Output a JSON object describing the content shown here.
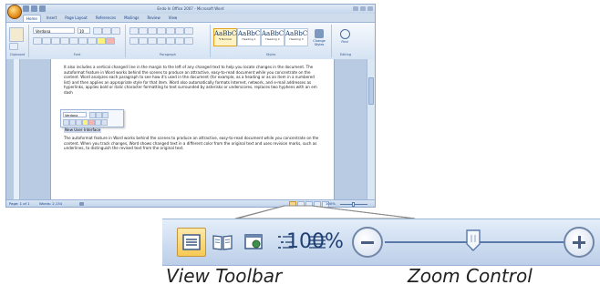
{
  "word_window": {
    "title": "Endo In Office 2007 - Microsoft Word",
    "ribbon_tabs": [
      "Home",
      "Insert",
      "Page Layout",
      "References",
      "Mailings",
      "Review",
      "View"
    ],
    "active_tab": "Home",
    "font_name": "Verdana",
    "font_size": "10",
    "groups": {
      "clipboard": "Clipboard",
      "font": "Font",
      "paragraph": "Paragraph",
      "styles": "Styles",
      "editing": "Editing"
    },
    "styles": [
      {
        "sample": "AaBbCcD",
        "name": "¶ Normal"
      },
      {
        "sample": "AaBbC",
        "name": "Heading 1"
      },
      {
        "sample": "AaBbC",
        "name": "Heading 2"
      },
      {
        "sample": "AaBbC",
        "name": "Heading 3"
      }
    ],
    "change_styles_label": "Change Styles",
    "find_label": "Find",
    "paragraphs": [
      "It also includes a vertical changed line in the margin to the left of any changed text to help you locate changes in the document. The autoformat feature in Word works behind the scenes to produce an attractive, easy-to-read document while you concentrate on the content. Word analyzes each paragraph to see how it's used in the document (for example, as a heading or as an item in a numbered list) and then applies an appropriate style for that item. Word also automatically formats Internet, network, and e-mail addresses as hyperlinks, applies bold or italic character formatting to text surrounded by asterisks or underscores, replaces two hyphens with an em dash",
      "The autoformat feature in Word works behind the scenes to produce an attractive, easy-to-read document while you concentrate on the content. When you track changes, Word shows changed text in a different color from the original text and uses revision marks, such as underlines, to distinguish the revised text from the original text."
    ],
    "selected_text": "New User Interface",
    "mini_toolbar_font": "Verdana",
    "status": {
      "page": "Page: 1 of 1",
      "words": "Words: 2,134",
      "zoom": "100%"
    }
  },
  "status_bar_zoomed": {
    "view_buttons": [
      {
        "name": "print-layout",
        "icon": "print-layout-icon",
        "active": true
      },
      {
        "name": "full-screen-reading",
        "icon": "book-icon",
        "active": false
      },
      {
        "name": "web-layout",
        "icon": "web-layout-icon",
        "active": false
      },
      {
        "name": "outline",
        "icon": "outline-icon",
        "active": false
      },
      {
        "name": "draft",
        "icon": "draft-icon",
        "active": false
      }
    ],
    "zoom_percent": "100%",
    "zoom_level": 100,
    "zoom_out_icon": "minus-icon",
    "zoom_in_icon": "plus-icon"
  },
  "captions": {
    "view_toolbar": "View Toolbar",
    "zoom_control": "Zoom Control"
  },
  "colors": {
    "office_blue": "#15428b",
    "active_view": "#f7c955",
    "panel_light": "#e4eef9",
    "panel_dark": "#bccfe8"
  }
}
